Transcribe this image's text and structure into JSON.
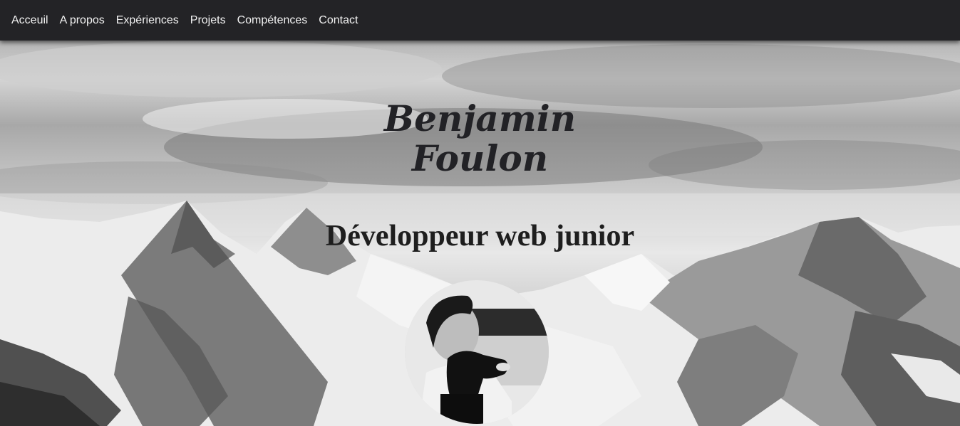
{
  "nav": {
    "items": [
      {
        "label": "Acceuil"
      },
      {
        "label": "A propos"
      },
      {
        "label": "Expériences"
      },
      {
        "label": "Projets"
      },
      {
        "label": "Compétences"
      },
      {
        "label": "Contact"
      }
    ]
  },
  "hero": {
    "name_line1": "Benjamin",
    "name_line2": "Foulon",
    "subtitle": "Développeur web junior",
    "background": "mountain-landscape-grayscale",
    "avatar": "profile-photo-with-dog"
  },
  "colors": {
    "navbar_bg": "#232326",
    "nav_text": "#f2f2f2",
    "title_text": "#222226"
  }
}
